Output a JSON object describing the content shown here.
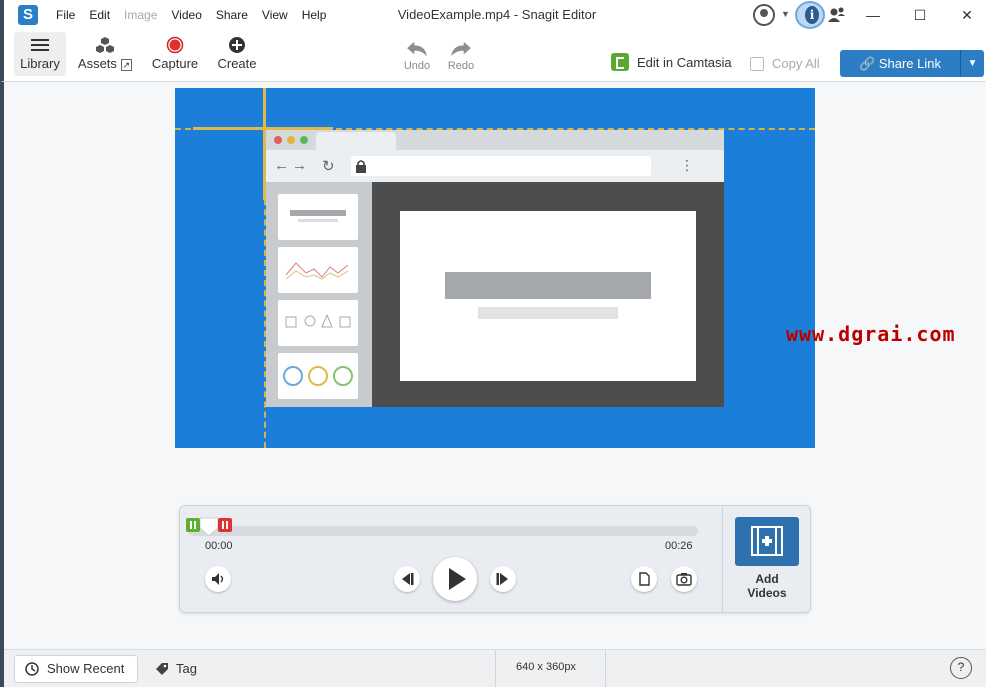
{
  "window": {
    "title": "VideoExample.mp4 - Snagit Editor",
    "app_logo": "S",
    "minimize": "—",
    "maximize": "☐",
    "close": "✕"
  },
  "menu": {
    "file": "File",
    "edit": "Edit",
    "image": "Image",
    "video": "Video",
    "share": "Share",
    "view": "View",
    "help": "Help"
  },
  "toolbar": {
    "library": "Library",
    "assets": "Assets",
    "capture": "Capture",
    "create": "Create",
    "undo": "Undo",
    "redo": "Redo",
    "edit_in_camtasia": "Edit in Camtasia",
    "copy_all": "Copy All",
    "share_link": "Share Link"
  },
  "watermark": "www.dgrai.com",
  "player": {
    "current_time": "00:00",
    "duration": "00:26",
    "add_videos_line1": "Add",
    "add_videos_line2": "Videos"
  },
  "statusbar": {
    "show_recent": "Show Recent",
    "tag": "Tag",
    "dimensions": "640 x 360px",
    "help": "?"
  },
  "colors": {
    "accent": "#2d7dc4",
    "video_bg": "#1b7fd9",
    "guide": "#d9b34a",
    "capture_red": "#e03030",
    "camtasia_green": "#5aa832"
  }
}
